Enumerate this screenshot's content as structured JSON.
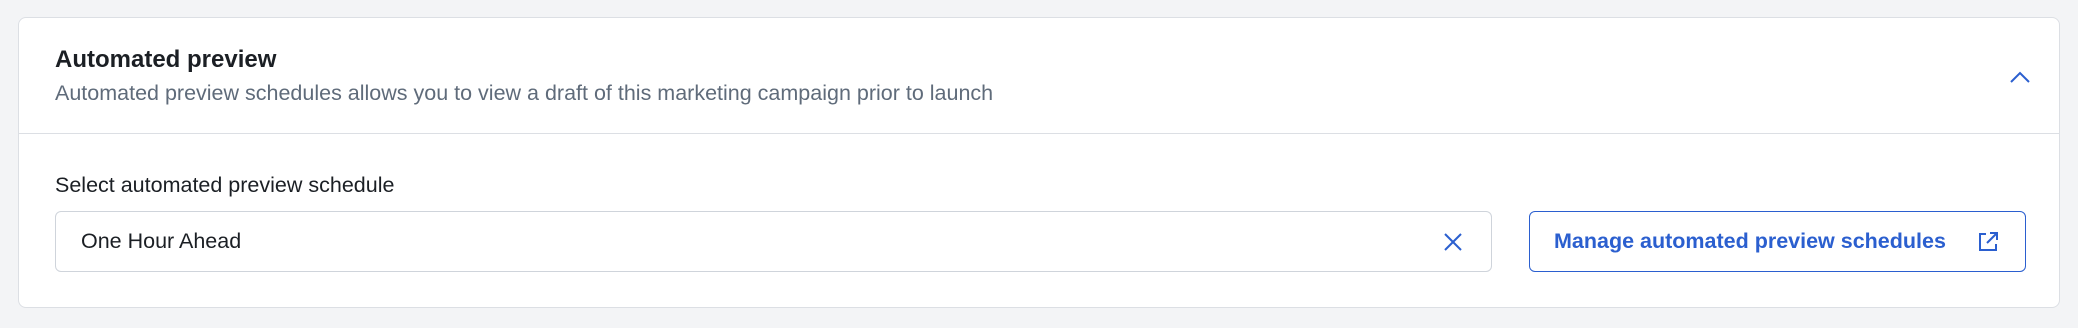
{
  "section": {
    "title": "Automated preview",
    "description": "Automated preview schedules allows you to view a draft of this marketing campaign prior to launch",
    "collapse_icon": "chevron-up-icon"
  },
  "schedule_field": {
    "label": "Select automated preview schedule",
    "selected_value": "One Hour Ahead",
    "clear_icon": "close-icon"
  },
  "manage_button": {
    "label": "Manage automated preview schedules",
    "icon": "external-link-icon"
  },
  "colors": {
    "accent": "#2b5fcf",
    "text_primary": "#1b1f24",
    "text_secondary": "#5f6b7a",
    "border": "#dcdfe4",
    "background": "#f3f4f6"
  }
}
